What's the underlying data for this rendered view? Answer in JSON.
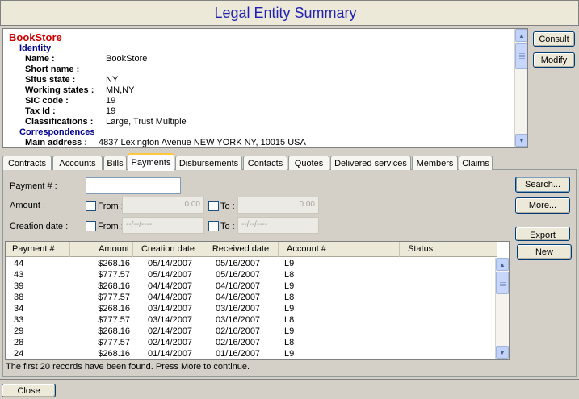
{
  "window": {
    "title": "Legal Entity Summary"
  },
  "summary": {
    "entity_name": "BookStore",
    "identity_title": "Identity",
    "fields": [
      {
        "label": "Name :",
        "value": "BookStore"
      },
      {
        "label": "Short name :",
        "value": ""
      },
      {
        "label": "Situs state :",
        "value": "NY"
      },
      {
        "label": "Working states :",
        "value": "MN,NY"
      },
      {
        "label": "SIC code :",
        "value": "19"
      },
      {
        "label": "Tax Id :",
        "value": "19"
      },
      {
        "label": "Classifications :",
        "value": "Large, Trust Multiple"
      }
    ],
    "correspondences_title": "Correspondences",
    "main_address_label": "Main address :",
    "main_address_value": "4837 Lexington Avenue  NEW YORK NY, 10015 USA"
  },
  "side_buttons": {
    "consult": "Consult",
    "modify": "Modify"
  },
  "tabs": [
    {
      "label": "Contracts"
    },
    {
      "label": "Accounts"
    },
    {
      "label": "Bills"
    },
    {
      "label": "Payments",
      "active": true
    },
    {
      "label": "Disbursements"
    },
    {
      "label": "Contacts"
    },
    {
      "label": "Quotes"
    },
    {
      "label": "Delivered services"
    },
    {
      "label": "Members"
    },
    {
      "label": "Claims"
    }
  ],
  "search_form": {
    "payment_label": "Payment # :",
    "payment_value": "",
    "amount_label": "Amount :",
    "from_label": "From :",
    "to_label": "To :",
    "amount_from": "0.00",
    "amount_to": "0.00",
    "creation_date_label": "Creation date :",
    "date_from": "--/--/----",
    "date_to": "--/--/----"
  },
  "action_buttons": {
    "search": "Search...",
    "more": "More...",
    "export": "Export",
    "new": "New"
  },
  "grid": {
    "columns": [
      "Payment #",
      "Amount",
      "Creation date",
      "Received date",
      "Account #",
      "Status"
    ],
    "rows": [
      [
        "44",
        "$268.16",
        "05/14/2007",
        "05/16/2007",
        "L9",
        ""
      ],
      [
        "43",
        "$777.57",
        "05/14/2007",
        "05/16/2007",
        "L8",
        ""
      ],
      [
        "39",
        "$268.16",
        "04/14/2007",
        "04/16/2007",
        "L9",
        ""
      ],
      [
        "38",
        "$777.57",
        "04/14/2007",
        "04/16/2007",
        "L8",
        ""
      ],
      [
        "34",
        "$268.16",
        "03/14/2007",
        "03/16/2007",
        "L9",
        ""
      ],
      [
        "33",
        "$777.57",
        "03/14/2007",
        "03/16/2007",
        "L8",
        ""
      ],
      [
        "29",
        "$268.16",
        "02/14/2007",
        "02/16/2007",
        "L9",
        ""
      ],
      [
        "28",
        "$777.57",
        "02/14/2007",
        "02/16/2007",
        "L8",
        ""
      ],
      [
        "24",
        "$268.16",
        "01/14/2007",
        "01/16/2007",
        "L9",
        ""
      ]
    ]
  },
  "status_message": "The first 20 records have been found. Press More to continue.",
  "footer": {
    "close": "Close"
  },
  "colors": {
    "title": "#1f1fb4",
    "entity_name": "#cc0000",
    "section_title": "#00008b",
    "active_tab_accent": "#ffc83c"
  }
}
